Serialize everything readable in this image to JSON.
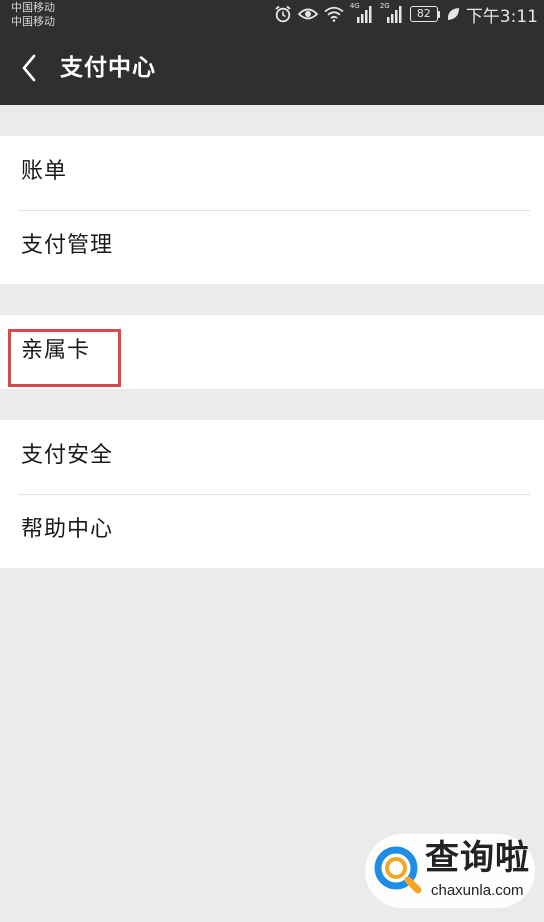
{
  "status_bar": {
    "carrier_1": "中国移动",
    "carrier_2": "中国移动",
    "network_1": "4G",
    "network_2": "2G",
    "battery": "82",
    "time": "下午3:11"
  },
  "header": {
    "title": "支付中心",
    "back_icon": "back-arrow-icon"
  },
  "groups": [
    {
      "items": [
        {
          "label": "账单"
        },
        {
          "label": "支付管理"
        }
      ]
    },
    {
      "items": [
        {
          "label": "亲属卡",
          "highlighted": true
        }
      ]
    },
    {
      "items": [
        {
          "label": "支付安全"
        },
        {
          "label": "帮助中心"
        }
      ]
    }
  ],
  "highlight_color": "#d44b4f",
  "watermark": {
    "title": "查询啦",
    "url": "chaxunla.com",
    "logo_colors": [
      "#1f8ce6",
      "#f5a623"
    ]
  }
}
